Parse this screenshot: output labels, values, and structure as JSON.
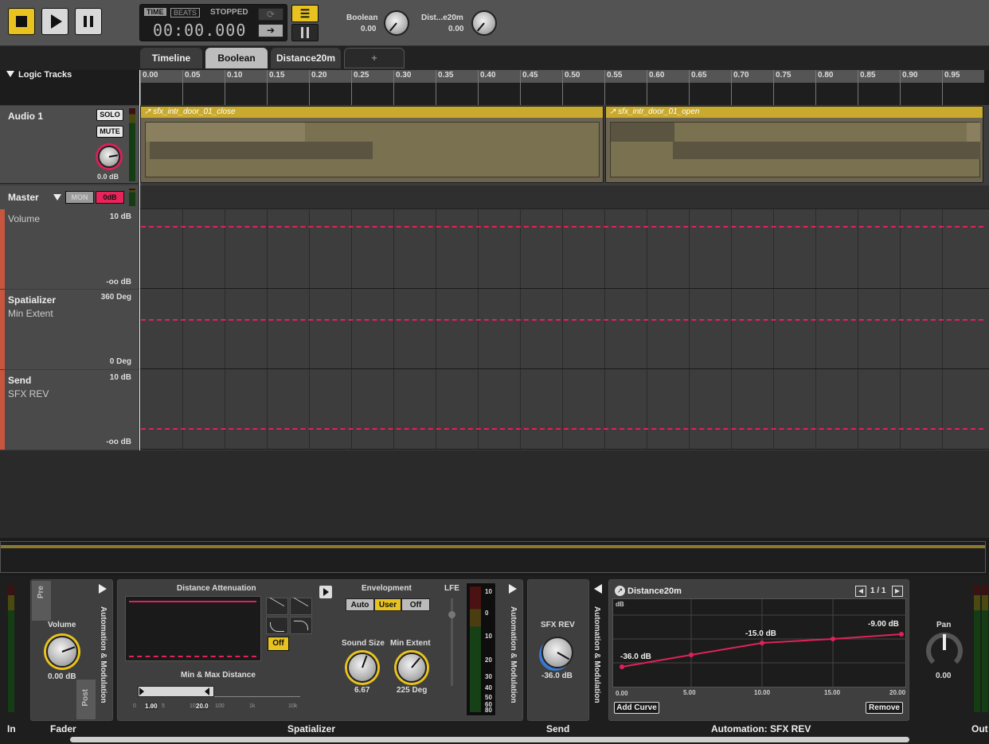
{
  "transport": {
    "time_label": "TIME",
    "beats_label": "BEATS",
    "status": "STOPPED",
    "timecode": "00:00.000"
  },
  "params": [
    {
      "name": "Boolean",
      "value": "0.00"
    },
    {
      "name": "Dist...e20m",
      "value": "0.00"
    }
  ],
  "tabs": [
    {
      "label": "Timeline"
    },
    {
      "label": "Boolean"
    },
    {
      "label": "Distance20m"
    },
    {
      "label": "+"
    }
  ],
  "logic_tracks": "Logic Tracks",
  "ruler": [
    "0.00",
    "0.05",
    "0.10",
    "0.15",
    "0.20",
    "0.25",
    "0.30",
    "0.35",
    "0.40",
    "0.45",
    "0.50",
    "0.55",
    "0.60",
    "0.65",
    "0.70",
    "0.75",
    "0.80",
    "0.85",
    "0.90",
    "0.95"
  ],
  "audio1": {
    "name": "Audio 1",
    "solo": "SOLO",
    "mute": "MUTE",
    "gain": "0.0 dB"
  },
  "clips": [
    {
      "name": "sfx_intr_door_01_close"
    },
    {
      "name": "sfx_intr_door_01_open"
    }
  ],
  "master": {
    "name": "Master",
    "mon": "MON",
    "db": "0dB"
  },
  "auto_lanes": [
    {
      "name": "Volume",
      "sub": "",
      "top": "10 dB",
      "bottom": "-oo dB"
    },
    {
      "name": "Spatializer",
      "sub": "Min Extent",
      "top": "360 Deg",
      "bottom": "0 Deg"
    },
    {
      "name": "Send",
      "sub": "SFX REV",
      "top": "10 dB",
      "bottom": "-oo dB"
    }
  ],
  "deck": {
    "fader": {
      "pre": "Pre",
      "post": "Post",
      "volume_label": "Volume",
      "volume_value": "0.00 dB",
      "automation": "Automation & Modulation"
    },
    "spatializer": {
      "title": "Distance Attenuation",
      "off": "Off",
      "minmax": "Min & Max Distance",
      "min_val": "1.00",
      "max_val": "20.0",
      "scale": [
        "0",
        "1",
        "5",
        "10",
        "100",
        "1k",
        "10k"
      ],
      "envelopment": "Envelopment",
      "env_modes": [
        "Auto",
        "User",
        "Off"
      ],
      "lfe": "LFE",
      "sound_size_label": "Sound Size",
      "sound_size": "6.67",
      "min_extent_label": "Min Extent",
      "min_extent": "225 Deg",
      "meter_scale": [
        "10",
        "0",
        "10",
        "20",
        "30",
        "40",
        "50",
        "60",
        "80"
      ],
      "automation": "Automation & Modulation"
    },
    "send": {
      "label": "SFX REV",
      "value": "-36.0 dB",
      "automation": "Automation & Modulation"
    },
    "curve": {
      "title": "Distance20m",
      "page": "1 / 1",
      "unit": "dB",
      "points": [
        "-36.0 dB",
        "-15.0 dB",
        "-9.00 dB"
      ],
      "x_ticks": [
        "0.00",
        "5.00",
        "10.00",
        "15.00",
        "20.00"
      ],
      "add": "Add Curve",
      "remove": "Remove"
    },
    "pan": {
      "label": "Pan",
      "value": "0.00"
    }
  },
  "footer": {
    "in": "In",
    "fader": "Fader",
    "spatializer": "Spatializer",
    "send": "Send",
    "automation": "Automation: SFX REV",
    "out": "Out"
  },
  "colors": {
    "accent": "#e8c31f",
    "clip": "#c9aa2e",
    "curve": "#e0225a"
  }
}
